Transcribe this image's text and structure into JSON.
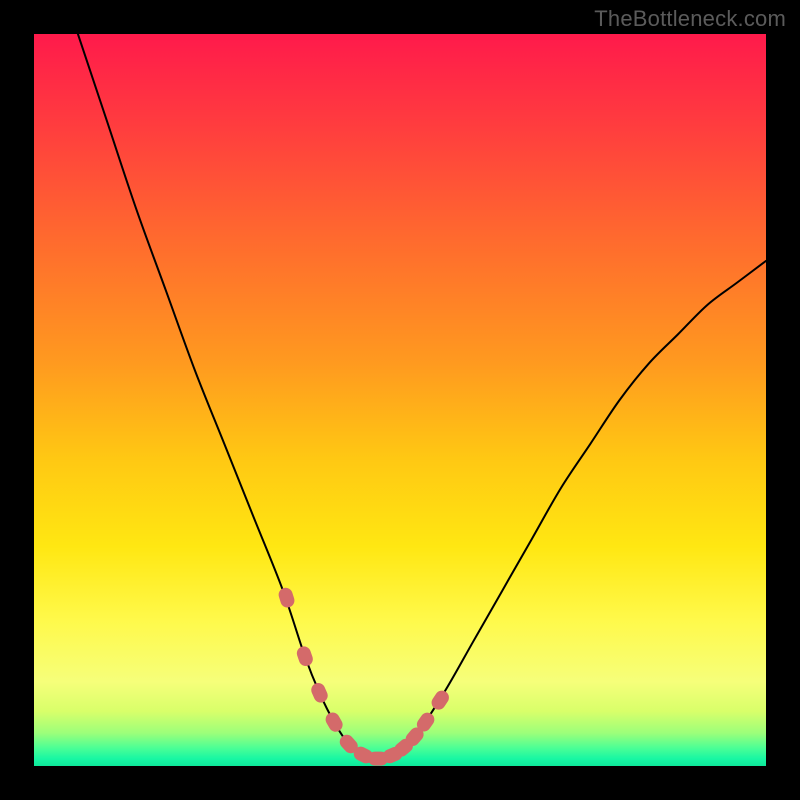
{
  "watermark": "TheBottleneck.com",
  "chart_data": {
    "type": "line",
    "title": "",
    "xlabel": "",
    "ylabel": "",
    "xlim": [
      0,
      100
    ],
    "ylim": [
      0,
      100
    ],
    "grid": false,
    "legend": false,
    "series": [
      {
        "name": "curve",
        "x": [
          6,
          10,
          14,
          18,
          22,
          26,
          30,
          34,
          37,
          39,
          41,
          43,
          45,
          47,
          49,
          52,
          56,
          60,
          64,
          68,
          72,
          76,
          80,
          84,
          88,
          92,
          96,
          100
        ],
        "y": [
          100,
          88,
          76,
          65,
          54,
          44,
          34,
          24,
          15,
          10,
          6,
          3,
          1.5,
          1,
          1.5,
          4,
          10,
          17,
          24,
          31,
          38,
          44,
          50,
          55,
          59,
          63,
          66,
          69
        ]
      }
    ],
    "markers": {
      "name": "highlighted-points",
      "color": "#d46a6a",
      "x": [
        34.5,
        37,
        39,
        41,
        43,
        45,
        47,
        49,
        50.5,
        52,
        53.5,
        55.5
      ],
      "y": [
        23,
        15,
        10,
        6,
        3,
        1.5,
        1,
        1.5,
        2.5,
        4,
        6,
        9
      ]
    },
    "gradient_stops": [
      {
        "offset": 0.0,
        "color": "#ff1a4b"
      },
      {
        "offset": 0.12,
        "color": "#ff3b3f"
      },
      {
        "offset": 0.28,
        "color": "#ff6a2e"
      },
      {
        "offset": 0.45,
        "color": "#ff9a1f"
      },
      {
        "offset": 0.58,
        "color": "#ffc813"
      },
      {
        "offset": 0.7,
        "color": "#ffe712"
      },
      {
        "offset": 0.8,
        "color": "#fff94a"
      },
      {
        "offset": 0.885,
        "color": "#f6ff7a"
      },
      {
        "offset": 0.925,
        "color": "#d9ff6a"
      },
      {
        "offset": 0.955,
        "color": "#9cff7a"
      },
      {
        "offset": 0.975,
        "color": "#4dff95"
      },
      {
        "offset": 0.99,
        "color": "#18f7a3"
      },
      {
        "offset": 1.0,
        "color": "#0ee89a"
      }
    ]
  }
}
